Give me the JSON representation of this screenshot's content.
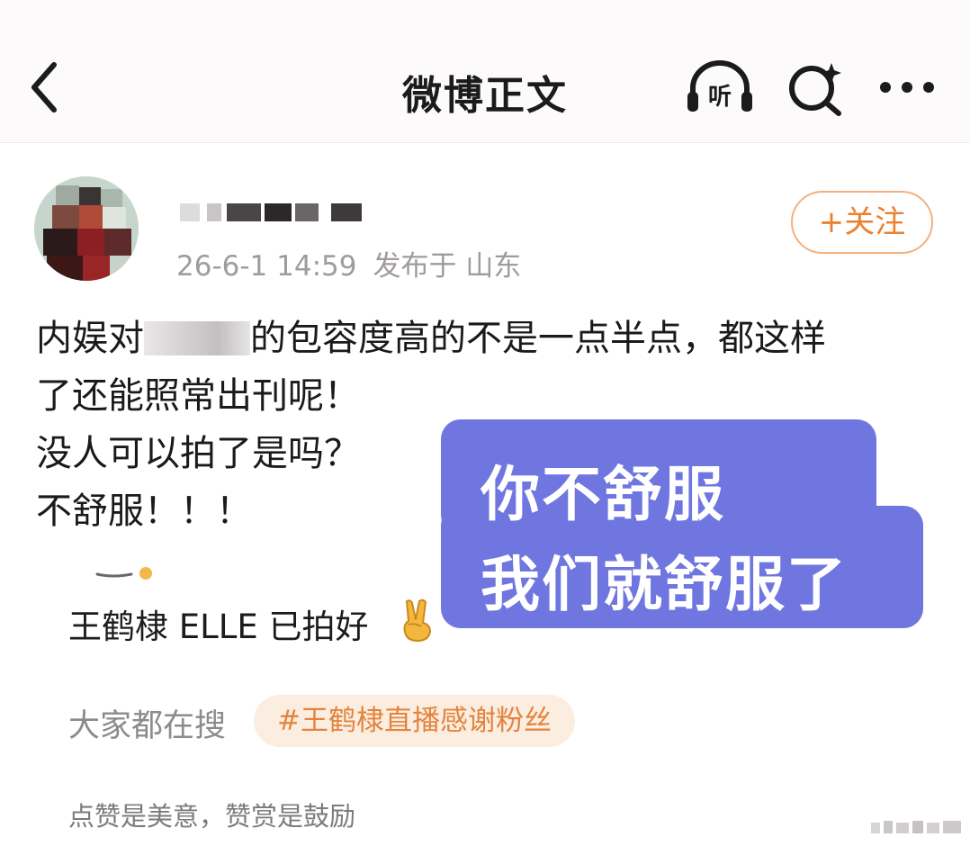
{
  "nav": {
    "title": "微博正文",
    "listen_label": "听",
    "icons": [
      "back-arrow-icon",
      "headphones-listen-icon",
      "search-sparkle-icon",
      "more-dots-icon"
    ]
  },
  "post": {
    "date": "26-6-1 14:59",
    "location": "发布于 山东",
    "follow_label": "+关注",
    "body": {
      "line1_start": "内娱对",
      "line1_end": "的包容度高的不是一点半点，都这样",
      "line2": "了还能照常出刊呢！",
      "line3": "没人可以拍了是吗？",
      "line4": "不舒服！！！"
    }
  },
  "sticker": {
    "line1": "你不舒服",
    "line2": "我们就舒服了",
    "color": "#6f76e0"
  },
  "quote": {
    "text": "王鹤棣 ELLE 已拍好",
    "emoji": "victory-hand-emoji"
  },
  "search": {
    "label": "大家都在搜",
    "chip": "#王鹤棣直播感谢粉丝"
  },
  "footer": {
    "note": "点赞是美意，赞赏是鼓励"
  },
  "colors": {
    "accent_orange": "#ee7f2f",
    "chip_bg": "#fbeee0",
    "meta_gray": "#a09b9d"
  }
}
